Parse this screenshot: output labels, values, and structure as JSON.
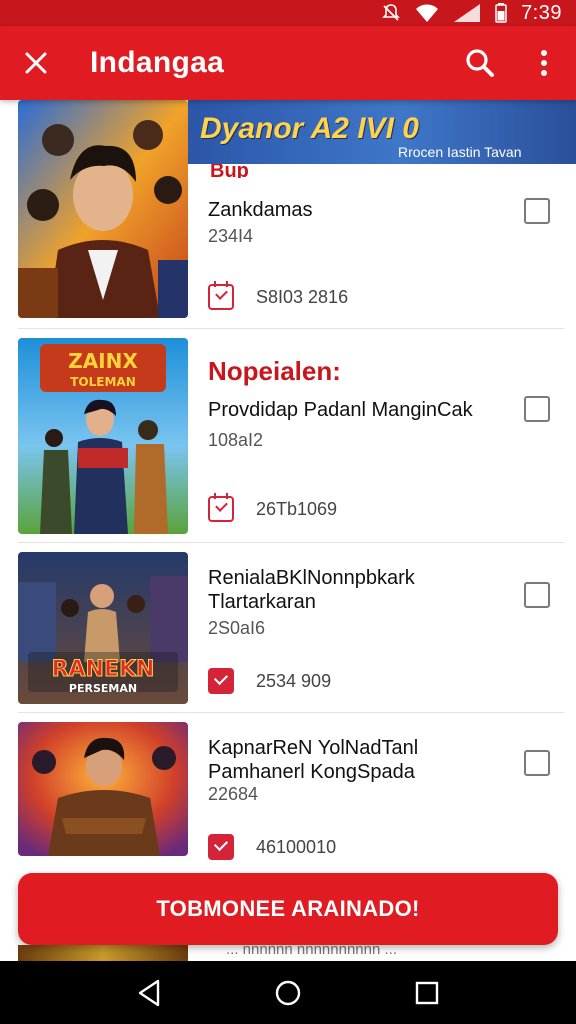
{
  "status_bar": {
    "time": "7:39"
  },
  "app_bar": {
    "title": "Indangaa"
  },
  "banner": {
    "text": "Dyanor A2 IVI 0",
    "subtext": "Rrocen Iastin Tavan",
    "cut_heading": "Bup"
  },
  "items": [
    {
      "title": "Zankdamas",
      "count": "234I4",
      "meta": "S8I03 2816",
      "checked_icon": "outline"
    },
    {
      "heading": "Nopeialen:",
      "title": "Provdidap Padanl ManginCak",
      "count": "108aI2",
      "meta": "26Tb1069",
      "checked_icon": "outline"
    },
    {
      "title": "RenialaBKlNonnpbkark Tlartarkaran",
      "count": "2S0aI6",
      "meta": "2534 909",
      "checked_icon": "filled"
    },
    {
      "title": "KapnarReN YolNadTanl Pamhanerl KongSpada",
      "count": "22684",
      "meta": "46100010",
      "checked_icon": "filled"
    }
  ],
  "thumbnails": {
    "item2_logo": "ZAINX\nTOLEMAN",
    "item3_logo": "RANEKN\nPERSEMAN"
  },
  "primary_button": {
    "label": "TOBMONEE ARAINADO!"
  },
  "peek": {
    "text": "... nnnnnn nnnnnnnnnn ..."
  },
  "colors": {
    "accent": "#e01b22",
    "status_bar": "#c8161d",
    "heading": "#c8161d"
  }
}
